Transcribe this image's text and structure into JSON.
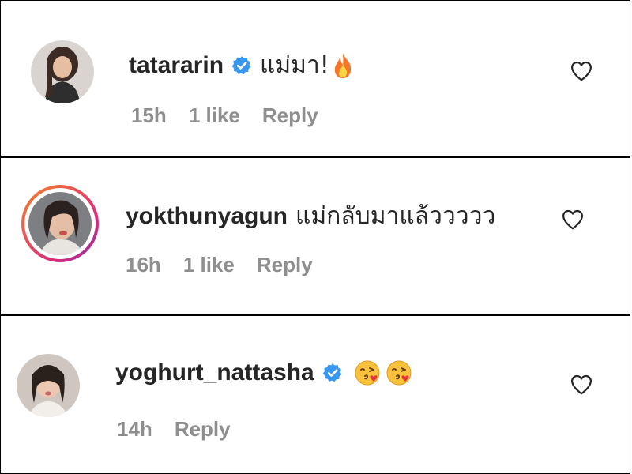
{
  "comments": [
    {
      "username": "tatararin",
      "verified": true,
      "text": "แม่มา!",
      "emojis": [
        "fire-emoji"
      ],
      "time": "15h",
      "likes": "1 like",
      "reply_label": "Reply",
      "avatar_story_ring": false
    },
    {
      "username": "yokthunyagun",
      "verified": false,
      "text": "แม่กลับมาแล้ววววว",
      "emojis": [],
      "time": "16h",
      "likes": "1 like",
      "reply_label": "Reply",
      "avatar_story_ring": true
    },
    {
      "username": "yoghurt_nattasha",
      "verified": true,
      "text": "",
      "emojis": [
        "face-blowing-kiss-emoji",
        "face-blowing-kiss-emoji"
      ],
      "time": "14h",
      "reply_label": "Reply",
      "avatar_story_ring": false
    }
  ],
  "icons": {
    "like": "heart-outline-icon",
    "verified": "verified-badge-icon"
  },
  "colors": {
    "username": "#262626",
    "meta": "#8e8e8e",
    "verified_blue": "#3897f0",
    "story_ring_start": "#f58529",
    "story_ring_end": "#dd2a7b"
  }
}
